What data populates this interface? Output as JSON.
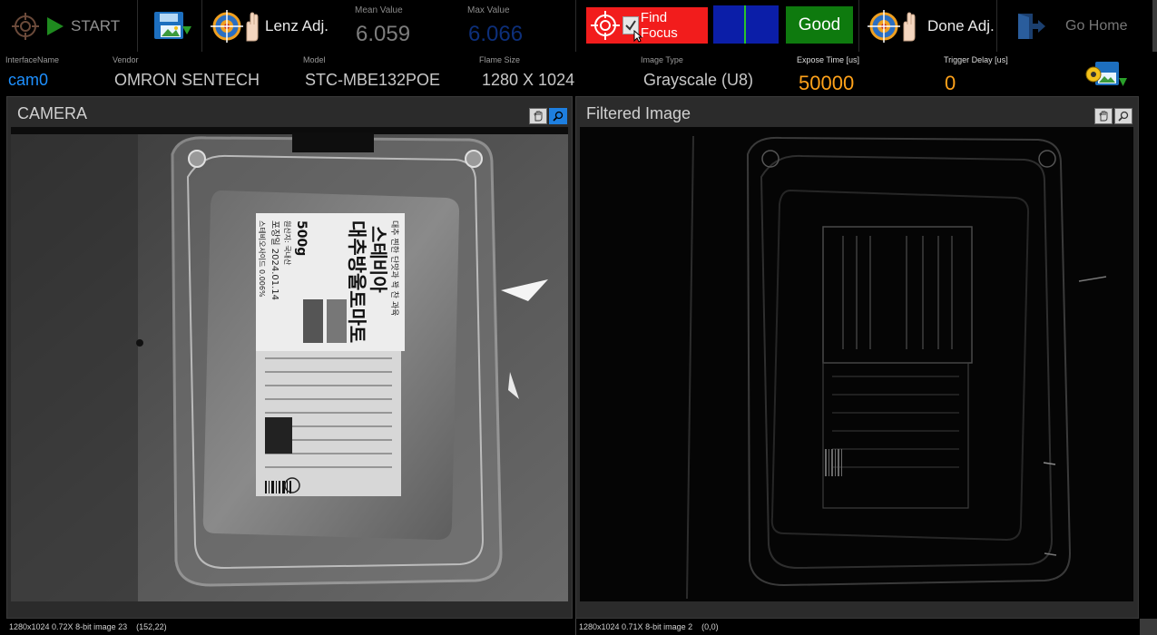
{
  "toolbar": {
    "start_label": "START",
    "lenz_label": "Lenz Adj.",
    "mean_label": "Mean Value",
    "mean_value": "6.059",
    "max_label": "Max Value",
    "max_value": "6.066",
    "find_focus_label": "Find Focus",
    "find_focus_checked": true,
    "good_label": "Good",
    "done_label": "Done Adj.",
    "go_home_label": "Go Home"
  },
  "camera_info": {
    "interface_label": "InterfaceName",
    "interface_value": "cam0",
    "vendor_label": "Vendor",
    "vendor_value": "OMRON SENTECH",
    "model_label": "Model",
    "model_value": "STC-MBE132POE",
    "frame_label": "Flame Size",
    "frame_value": "1280 X 1024",
    "image_type_label": "Image Type",
    "image_type_value": "Grayscale (U8)",
    "expose_label": "Expose Time [us]",
    "expose_value": "50000",
    "trigger_label": "Trigger Delay [us]",
    "trigger_value": "0"
  },
  "panels": {
    "camera": {
      "title": "CAMERA",
      "status": "1280x1024 0.72X 8-bit image 23",
      "coord": "(152,22)"
    },
    "filtered": {
      "title": "Filtered Image",
      "status": "1280x1024 0.71X 8-bit image 2",
      "coord": "(0,0)"
    }
  },
  "label_text": {
    "line1": "대추 찐한 단맛과 꽉 찬 과육",
    "line2": "스테비아",
    "line3": "대추방울토마토",
    "weight": "500g",
    "origin": "원산지: 국내산",
    "date": "포장일 2024.01.14",
    "sweetener": "스테비오사이드 0.006%"
  },
  "colors": {
    "accent_blue": "#1e90ff",
    "orange": "#ffa21a",
    "good_green": "#0e7a0e",
    "focus_red": "#f21c1c",
    "indicator_blue": "#0b1ea8"
  },
  "icons": {
    "start": "target-icon",
    "play": "play-icon",
    "save": "save-image-icon",
    "lenz": "hand-target-icon",
    "done": "hand-target-icon",
    "home": "exit-door-icon",
    "settings": "image-settings-icon",
    "pan": "hand-icon",
    "zoom": "magnifier-icon"
  }
}
